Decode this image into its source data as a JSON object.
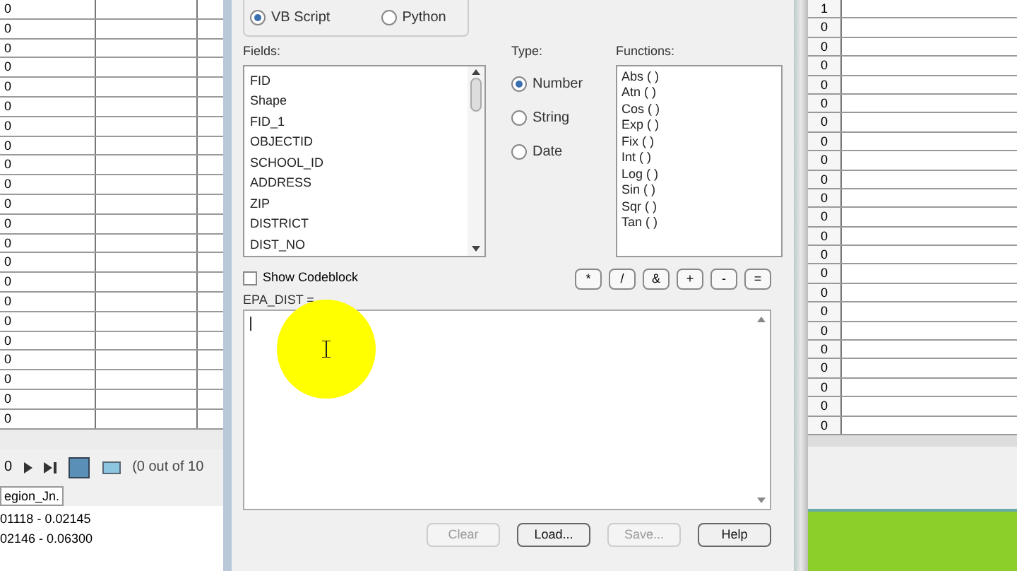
{
  "left_table": {
    "cells": [
      "0",
      "0",
      "0",
      "0",
      "0",
      "0",
      "0",
      "0",
      "0",
      "0",
      "0",
      "0",
      "0",
      "0",
      "0",
      "0",
      "0",
      "0",
      "0",
      "0",
      "0",
      "0"
    ]
  },
  "left_nav": {
    "record": "0",
    "status": "(0 out of 10"
  },
  "left_tab": {
    "label": "egion_Jn."
  },
  "legend": [
    "01118 - 0.02145",
    "02146 - 0.06300"
  ],
  "dialog": {
    "parser": {
      "options": [
        {
          "label": "VB Script",
          "selected": true
        },
        {
          "label": "Python",
          "selected": false
        }
      ]
    },
    "fields": {
      "label": "Fields:",
      "items": [
        "FID",
        "Shape",
        "FID_1",
        "OBJECTID",
        "SCHOOL_ID",
        "ADDRESS",
        "ZIP",
        "DISTRICT",
        "DIST_NO"
      ]
    },
    "type": {
      "label": "Type:",
      "options": [
        {
          "label": "Number",
          "selected": true
        },
        {
          "label": "String",
          "selected": false
        },
        {
          "label": "Date",
          "selected": false
        }
      ]
    },
    "functions": {
      "label": "Functions:",
      "items": [
        "Abs ( )",
        "Atn ( )",
        "Cos ( )",
        "Exp ( )",
        "Fix ( )",
        "Int ( )",
        "Log ( )",
        "Sin ( )",
        "Sqr ( )",
        "Tan ( )"
      ]
    },
    "show_codeblock": {
      "label": "Show Codeblock",
      "checked": false
    },
    "operators": [
      "*",
      "/",
      "&",
      "+",
      "-",
      "="
    ],
    "expression": {
      "label": "EPA_DIST ="
    },
    "buttons": [
      {
        "label": "Clear",
        "disabled": true
      },
      {
        "label": "Load...",
        "disabled": false
      },
      {
        "label": "Save...",
        "disabled": true
      },
      {
        "label": "Help",
        "disabled": false
      }
    ]
  },
  "right_table": {
    "cells": [
      "1",
      "0",
      "0",
      "0",
      "0",
      "0",
      "0",
      "0",
      "0",
      "0",
      "0",
      "0",
      "0",
      "0",
      "0",
      "0",
      "0",
      "0",
      "0",
      "0",
      "0",
      "0",
      "0"
    ]
  }
}
